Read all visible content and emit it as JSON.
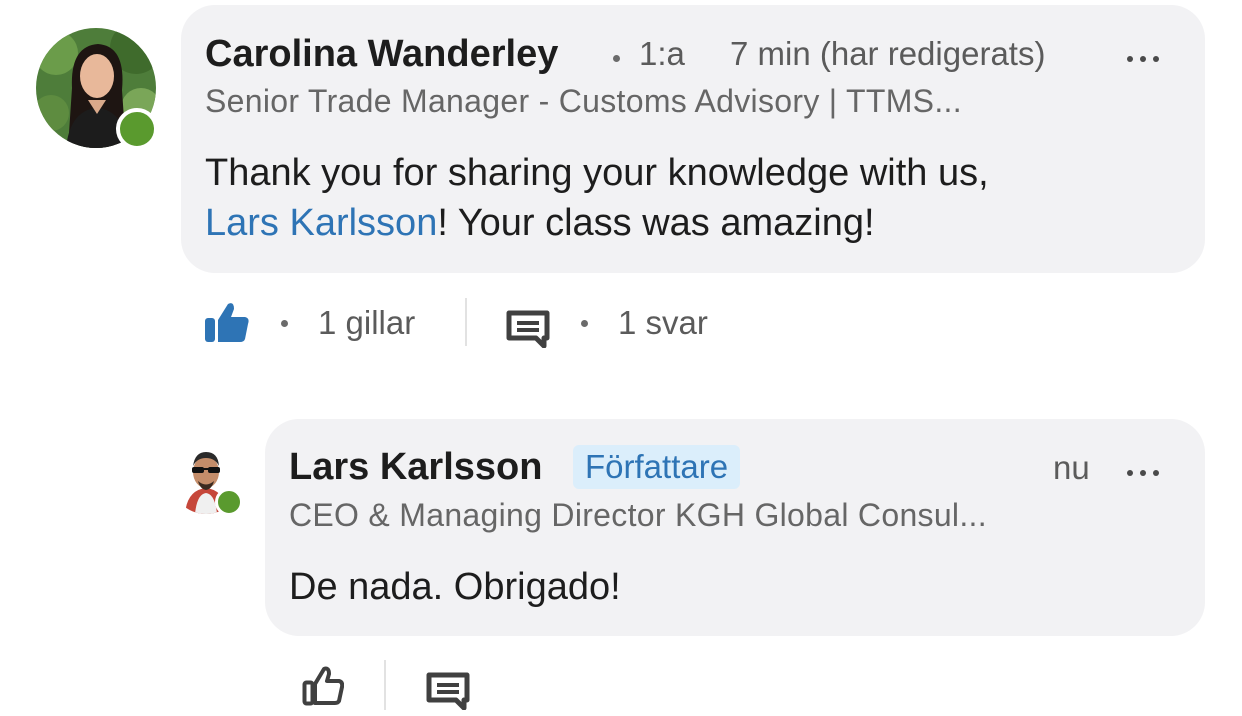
{
  "comment": {
    "author": "Carolina Wanderley",
    "degree": "1:a",
    "time": "7 min (har redigerats)",
    "headline": "Senior Trade Manager - Customs Advisory | TTMS...",
    "text_line1": "Thank you for sharing your knowledge with us,",
    "mention": "Lars Karlsson",
    "text_line2_rest": "! Your class was amazing!",
    "likes": "1 gillar",
    "replies": "1 svar"
  },
  "reply": {
    "author": "Lars Karlsson",
    "badge": "Författare",
    "time": "nu",
    "headline": "CEO & Managing Director KGH Global Consul...",
    "text": "De nada. Obrigado!"
  },
  "icons": {
    "liked": "thumbs-up-filled-icon",
    "like": "thumbs-up-outline-icon",
    "reply": "comment-icon",
    "more": "more-options-icon",
    "presence": "online-status-dot"
  },
  "colors": {
    "bubble": "#f2f2f4",
    "link": "#2e74b5",
    "badge_bg": "#dbeefb",
    "presence": "#5a9a2e"
  }
}
